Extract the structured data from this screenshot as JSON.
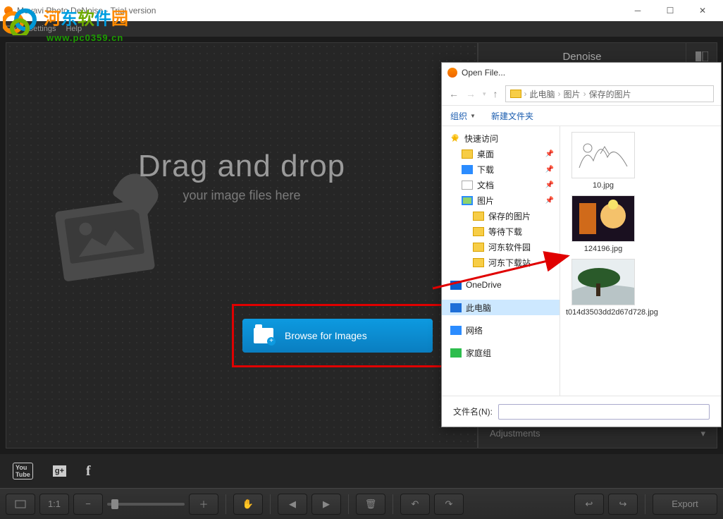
{
  "window": {
    "title": "Movavi Photo DeNoise - Trial version"
  },
  "menubar": {
    "file": "File",
    "settings": "Settings",
    "help": "Help"
  },
  "dropzone": {
    "heading": "Drag and drop",
    "sub": "your image files here"
  },
  "browse": {
    "label": "Browse for Images"
  },
  "sidebar": {
    "tab": "Denoise",
    "adjustments": "Adjustments"
  },
  "toolbar": {
    "ratio": "1:1",
    "export": "Export"
  },
  "dialog": {
    "title": "Open File...",
    "crumbs": [
      "此电脑",
      "图片",
      "保存的图片"
    ],
    "tools": {
      "org": "组织",
      "new": "新建文件夹"
    },
    "tree": {
      "quick": "快速访问",
      "items1": [
        {
          "label": "桌面",
          "icon": "folder",
          "pin": true
        },
        {
          "label": "下载",
          "icon": "dl",
          "pin": true
        },
        {
          "label": "文档",
          "icon": "doc",
          "pin": true
        },
        {
          "label": "图片",
          "icon": "pic",
          "pin": true
        }
      ],
      "items2": [
        {
          "label": "保存的图片",
          "icon": "folder"
        },
        {
          "label": "等待下载",
          "icon": "folder"
        },
        {
          "label": "河东软件园",
          "icon": "folder"
        },
        {
          "label": "河东下载站",
          "icon": "folder"
        }
      ],
      "onedrive": "OneDrive",
      "thispc": "此电脑",
      "network": "网络",
      "homegroup": "家庭组"
    },
    "files": [
      {
        "name": "10.jpg"
      },
      {
        "name": "124196.jpg"
      },
      {
        "name": "t014d3503dd2d67d728.jpg"
      }
    ],
    "filename_label": "文件名(N):"
  },
  "watermark": {
    "text": "河东软件园",
    "url": "www.pc0359.cn"
  }
}
